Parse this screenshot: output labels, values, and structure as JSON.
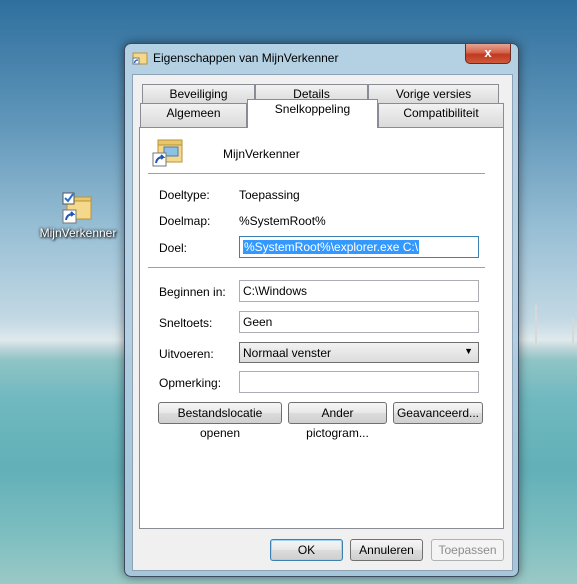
{
  "desktop": {
    "icon_label": "MijnVerkenner"
  },
  "window": {
    "title": "Eigenschappen van MijnVerkenner",
    "close_glyph": "x"
  },
  "tabs": {
    "row1": [
      "Beveiliging",
      "Details",
      "Vorige versies"
    ],
    "row2": [
      "Algemeen",
      "Snelkoppeling",
      "Compatibiliteit"
    ],
    "active": "Snelkoppeling"
  },
  "shortcut": {
    "name": "MijnVerkenner",
    "target_type_label": "Doeltype:",
    "target_type_value": "Toepassing",
    "target_location_label": "Doelmap:",
    "target_location_value": "%SystemRoot%",
    "target_label": "Doel:",
    "target_value": "%SystemRoot%\\explorer.exe C:\\",
    "start_in_label": "Beginnen in:",
    "start_in_value": "C:\\Windows",
    "shortcut_key_label": "Sneltoets:",
    "shortcut_key_value": "Geen",
    "run_label": "Uitvoeren:",
    "run_value": "Normaal venster",
    "comment_label": "Opmerking:",
    "comment_value": ""
  },
  "panel_buttons": {
    "open_location": "Bestandslocatie openen",
    "change_icon": "Ander pictogram...",
    "advanced": "Geavanceerd..."
  },
  "dialog_buttons": {
    "ok": "OK",
    "cancel": "Annuleren",
    "apply": "Toepassen"
  },
  "colors": {
    "selection": "#3399ff",
    "close_button": "#c0391f"
  }
}
